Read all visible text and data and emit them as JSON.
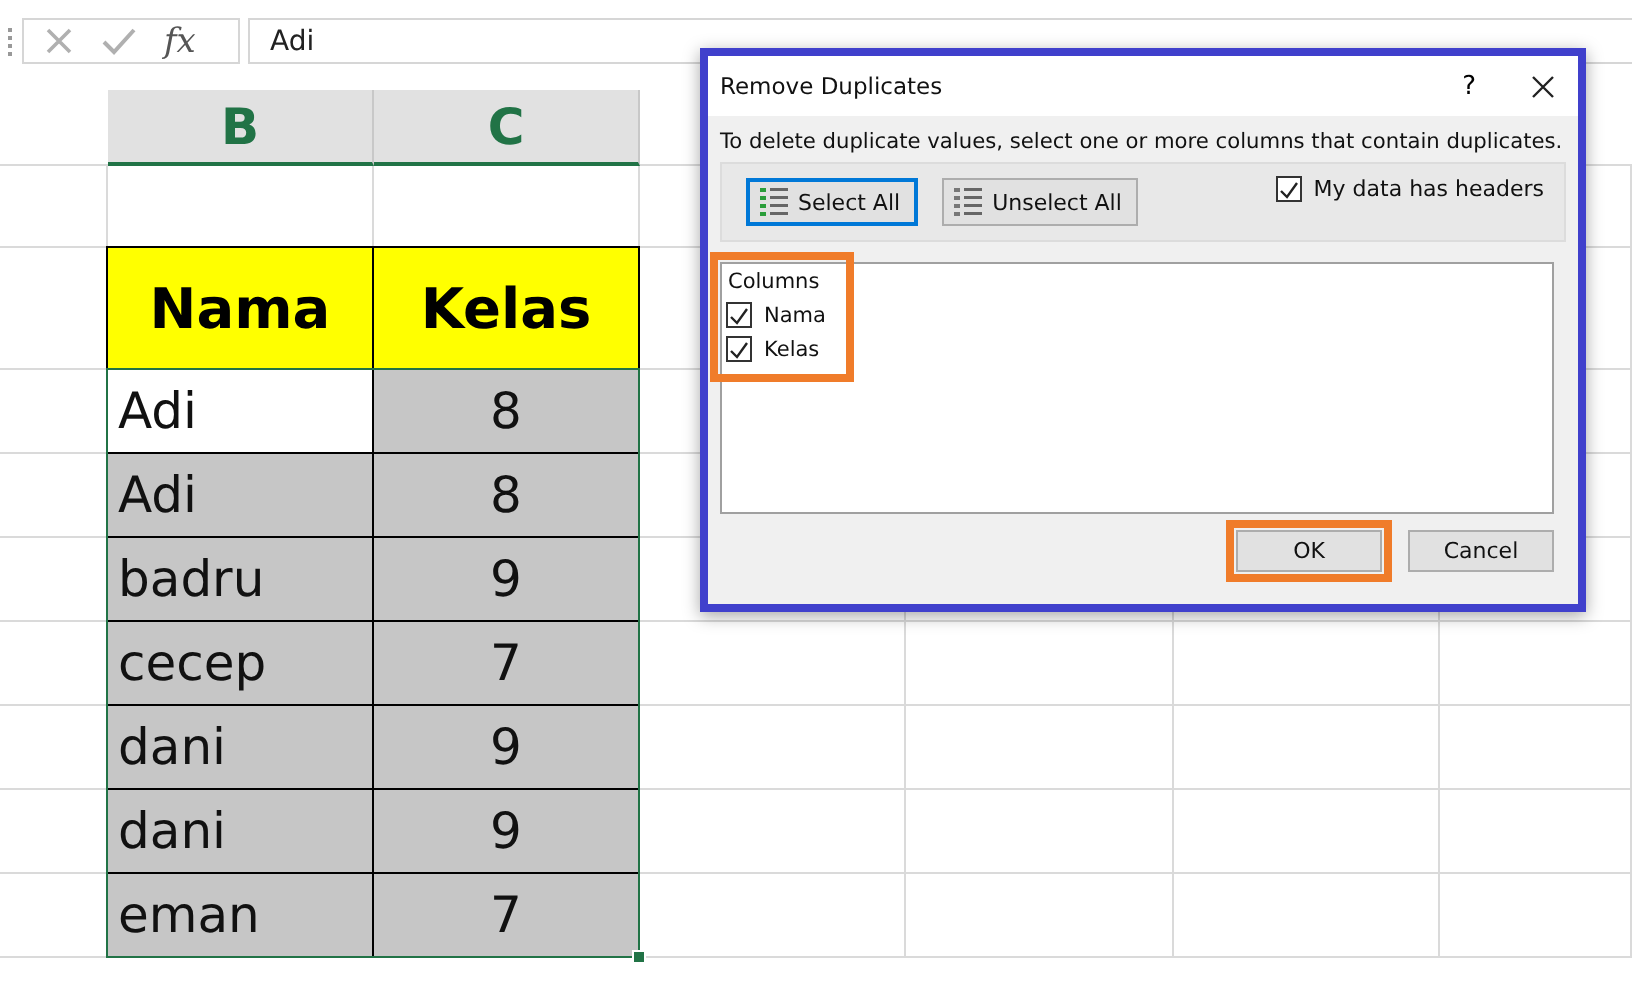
{
  "formula_bar": {
    "function_label": "fx",
    "value": "Adi"
  },
  "sheet": {
    "column_headers": [
      "B",
      "C"
    ],
    "table_header": [
      "Nama",
      "Kelas"
    ],
    "rows": [
      {
        "nama": "Adi",
        "kelas": "8",
        "active": true
      },
      {
        "nama": "Adi",
        "kelas": "8",
        "active": false
      },
      {
        "nama": "badru",
        "kelas": "9",
        "active": false
      },
      {
        "nama": "cecep",
        "kelas": "7",
        "active": false
      },
      {
        "nama": "dani",
        "kelas": "9",
        "active": false
      },
      {
        "nama": "dani",
        "kelas": "9",
        "active": false
      },
      {
        "nama": "eman",
        "kelas": "7",
        "active": false
      }
    ]
  },
  "dialog": {
    "title": "Remove Duplicates",
    "help": "?",
    "highlighted": true,
    "description": "To delete duplicate values, select one or more columns that contain duplicates.",
    "select_all": {
      "label": "Select All",
      "focused": true
    },
    "unselect_all": {
      "label": "Unselect All",
      "focused": false
    },
    "headers_checkbox": {
      "label": "My data has headers",
      "checked": true
    },
    "columns": {
      "label": "Columns",
      "highlighted": true,
      "items": [
        {
          "label": "Nama",
          "checked": true
        },
        {
          "label": "Kelas",
          "checked": true
        }
      ]
    },
    "buttons": [
      {
        "label": "OK",
        "highlighted": true
      },
      {
        "label": "Cancel",
        "highlighted": false
      }
    ]
  }
}
